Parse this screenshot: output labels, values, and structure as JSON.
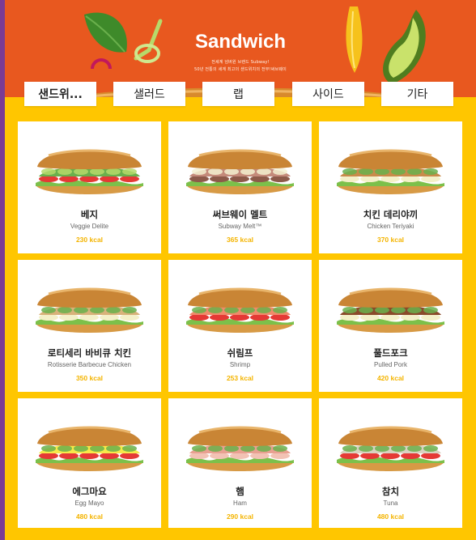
{
  "hero": {
    "title": "Sandwich",
    "subtitle_line1": "전세계 넘버원 브랜드 Subway!",
    "subtitle_line2": "50년 전통의 세계 최고의 샌드위치의 전부!써브웨이"
  },
  "tabs": [
    {
      "label": "샌드위...",
      "active": true
    },
    {
      "label": "샐러드",
      "active": false
    },
    {
      "label": "랩",
      "active": false
    },
    {
      "label": "사이드",
      "active": false
    },
    {
      "label": "기타",
      "active": false
    }
  ],
  "colors": {
    "hero_bg": "#e8581f",
    "band_bg": "#ffc600",
    "kcal": "#f4b400",
    "frame": "#7a3b94"
  },
  "products": [
    {
      "name_ko": "베지",
      "name_en": "Veggie Delite",
      "kcal": "230 kcal",
      "filling": "veggie"
    },
    {
      "name_ko": "써브웨이 멜트",
      "name_en": "Subway Melt™",
      "kcal": "365 kcal",
      "filling": "melt"
    },
    {
      "name_ko": "치킨 데리야끼",
      "name_en": "Chicken Teriyaki",
      "kcal": "370 kcal",
      "filling": "teriyaki"
    },
    {
      "name_ko": "로티세리 바비큐 치킨",
      "name_en": "Rotisserie Barbecue Chicken",
      "kcal": "350 kcal",
      "filling": "rotisserie"
    },
    {
      "name_ko": "쉬림프",
      "name_en": "Shrimp",
      "kcal": "253 kcal",
      "filling": "shrimp"
    },
    {
      "name_ko": "풀드포크",
      "name_en": "Pulled Pork",
      "kcal": "420 kcal",
      "filling": "pork"
    },
    {
      "name_ko": "에그마요",
      "name_en": "Egg Mayo",
      "kcal": "480 kcal",
      "filling": "egg"
    },
    {
      "name_ko": "햄",
      "name_en": "Ham",
      "kcal": "290 kcal",
      "filling": "ham"
    },
    {
      "name_ko": "참치",
      "name_en": "Tuna",
      "kcal": "480 kcal",
      "filling": "tuna"
    }
  ]
}
